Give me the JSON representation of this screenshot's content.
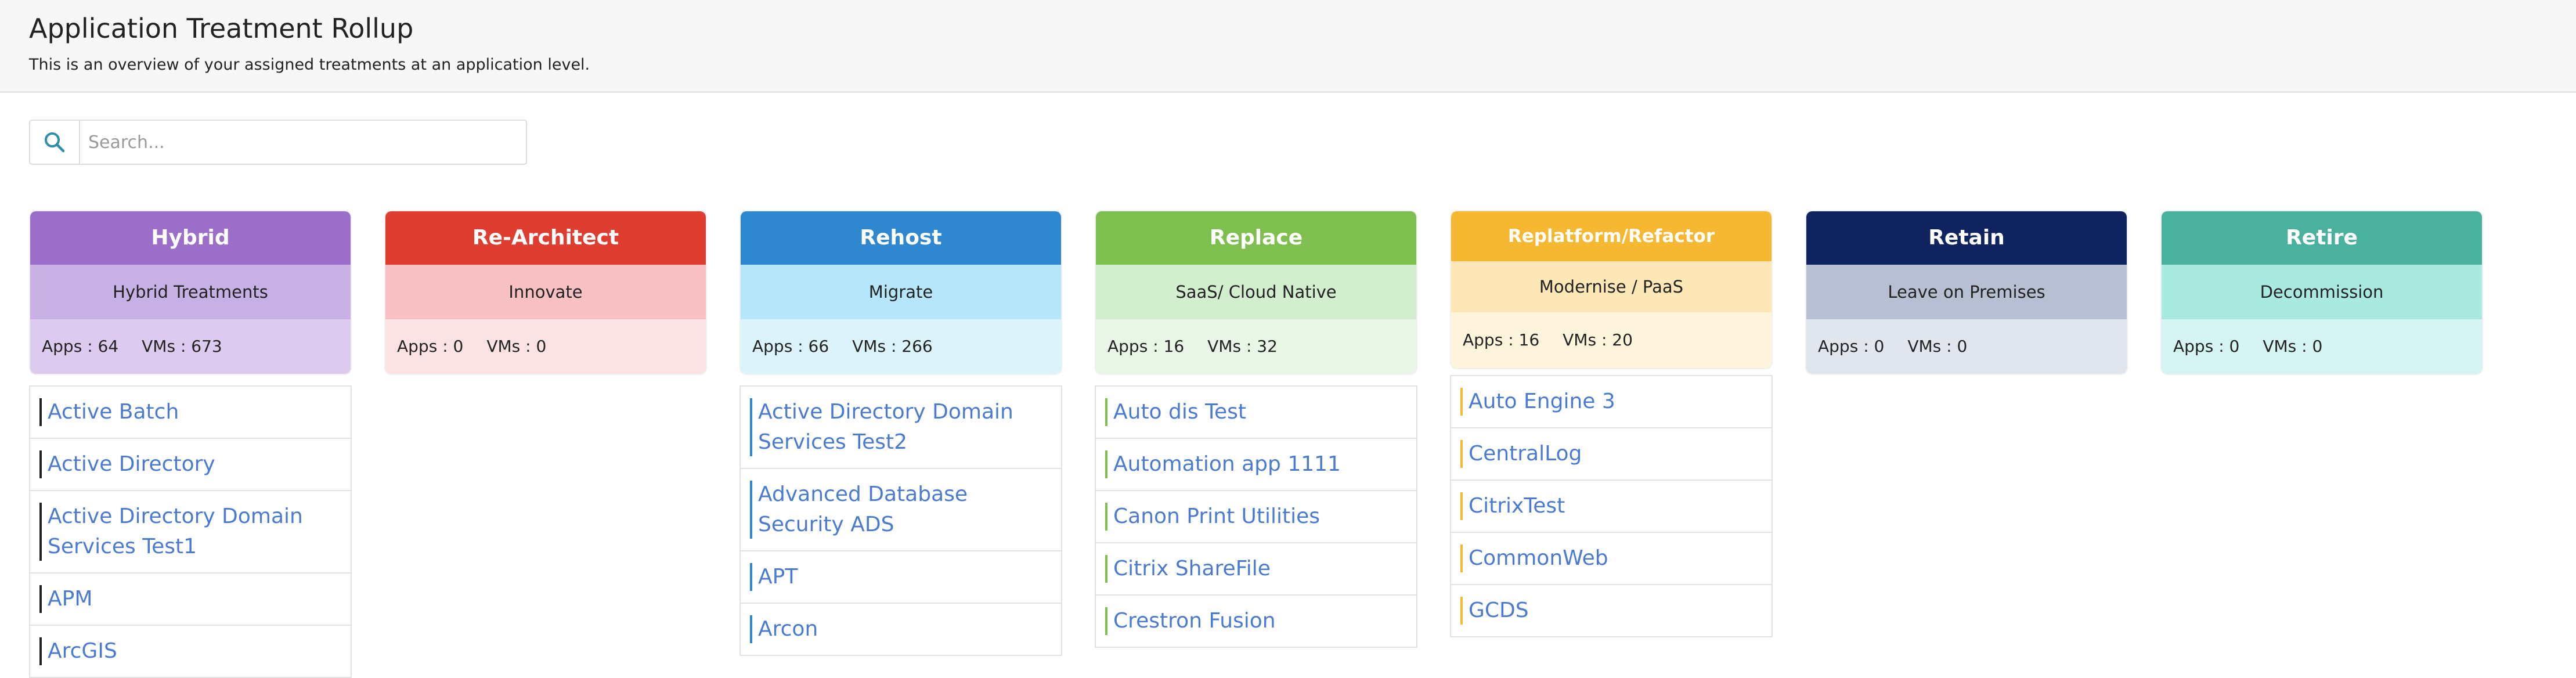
{
  "header": {
    "title": "Application Treatment Rollup",
    "subtitle": "This is an overview of your assigned treatments at an application level."
  },
  "search": {
    "placeholder": "Search..."
  },
  "columns": [
    {
      "name": "Hybrid",
      "subtitle": "Hybrid Treatments",
      "apps": "Apps : 64",
      "vms": "VMs : 673",
      "colors": {
        "head": "#9a6ec9",
        "sub": "#c7b0e3",
        "stats": "#dccbee",
        "accent": "#222222"
      },
      "items": [
        "Active Batch",
        "Active Directory",
        "Active Directory Domain Services Test1",
        "APM",
        "ArcGIS"
      ]
    },
    {
      "name": "Re-Architect",
      "subtitle": "Innovate",
      "apps": "Apps : 0",
      "vms": "VMs : 0",
      "colors": {
        "head": "#e03d31",
        "sub": "#f7c1c3",
        "stats": "#fbe2e3",
        "accent": "#e03d31"
      },
      "items": []
    },
    {
      "name": "Rehost",
      "subtitle": "Migrate",
      "apps": "Apps : 66",
      "vms": "VMs : 266",
      "colors": {
        "head": "#2f87d0",
        "sub": "#b5e6f9",
        "stats": "#dcf3fc",
        "accent": "#2f87d0"
      },
      "items": [
        "Active Directory Domain Services Test2",
        "Advanced Database Security ADS",
        "APT",
        "Arcon"
      ]
    },
    {
      "name": "Replace",
      "subtitle": "SaaS/ Cloud Native",
      "apps": "Apps : 16",
      "vms": "VMs : 32",
      "colors": {
        "head": "#7fbf4f",
        "sub": "#d3edcf",
        "stats": "#e8f6e6",
        "accent": "#7fbf4f"
      },
      "items": [
        "Auto dis Test",
        "Automation app 1111",
        "Canon Print Utilities",
        "Citrix ShareFile",
        "Crestron Fusion"
      ]
    },
    {
      "name": "Replatform/Refactor",
      "subtitle": "Modernise / PaaS",
      "apps": "Apps : 16",
      "vms": "VMs : 20",
      "colors": {
        "head": "#f5b830",
        "sub": "#fde7b6",
        "stats": "#fdf4db",
        "accent": "#f5b830"
      },
      "items": [
        "Auto Engine 3",
        "CentralLog",
        "CitrixTest",
        "CommonWeb",
        "GCDS"
      ]
    },
    {
      "name": "Retain",
      "subtitle": "Leave on Premises",
      "apps": "Apps : 0",
      "vms": "VMs : 0",
      "colors": {
        "head": "#0f2360",
        "sub": "#b7c0d3",
        "stats": "#e1e5ed",
        "accent": "#0f2360"
      },
      "items": []
    },
    {
      "name": "Retire",
      "subtitle": "Decommission",
      "apps": "Apps : 0",
      "vms": "VMs : 0",
      "colors": {
        "head": "#4ab19d",
        "sub": "#a9e9e0",
        "stats": "#d4f5f1",
        "accent": "#4ab19d"
      },
      "items": []
    }
  ]
}
